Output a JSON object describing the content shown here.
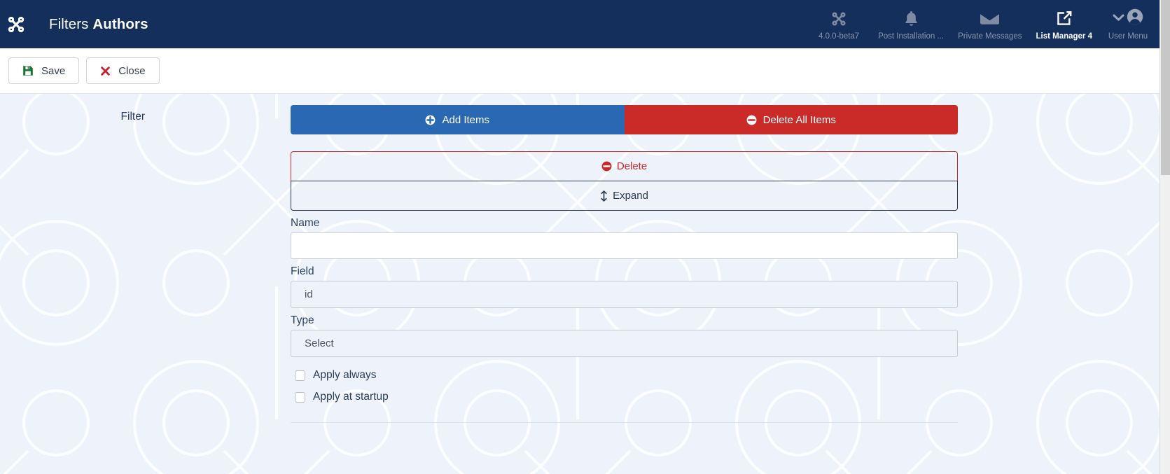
{
  "header": {
    "logo_icon": "joomla-logo-icon",
    "title_prefix": "Filters ",
    "title_bold": "Authors",
    "nav": [
      {
        "label": "4.0.0-beta7",
        "icon": "joomla-version-icon",
        "active": false
      },
      {
        "label": "Post Installation ...",
        "icon": "bell-icon",
        "active": false
      },
      {
        "label": "Private Messages",
        "icon": "envelope-icon",
        "active": false
      },
      {
        "label": "List Manager 4",
        "icon": "external-link-icon",
        "active": true
      },
      {
        "label": "User Menu",
        "icon": "user-icon",
        "active": false
      }
    ]
  },
  "toolbar": {
    "save_label": "Save",
    "save_icon": "floppy-disk-icon",
    "close_label": "Close",
    "close_icon": "x-mark-icon"
  },
  "form": {
    "group_label": "Filter",
    "add_items_label": "Add Items",
    "add_items_icon": "plus-circle-icon",
    "delete_all_label": "Delete All Items",
    "delete_all_icon": "minus-circle-icon",
    "item": {
      "delete_label": "Delete",
      "delete_icon": "minus-circle-icon",
      "expand_label": "Expand",
      "expand_icon": "arrows-vertical-icon",
      "name_label": "Name",
      "name_value": "",
      "name_placeholder": "",
      "field_label": "Field",
      "field_value": "id",
      "type_label": "Type",
      "type_value": "Select",
      "apply_always_label": "Apply always",
      "apply_always_checked": false,
      "apply_startup_label": "Apply at startup",
      "apply_startup_checked": false
    }
  },
  "colors": {
    "header_bg": "#142f5b",
    "primary": "#2a68b4",
    "danger": "#ca2a28",
    "page_bg": "#eef2fa",
    "text": "#29405f",
    "save_icon": "#1a7332",
    "close_icon": "#c82333"
  }
}
